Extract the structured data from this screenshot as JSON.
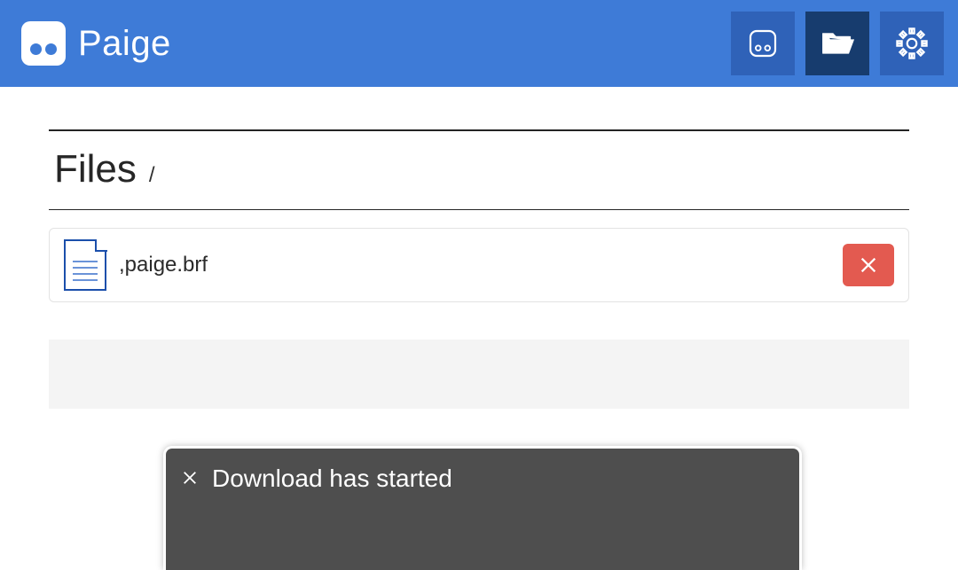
{
  "header": {
    "brand_name": "Paige",
    "buttons": {
      "device": "device-icon",
      "files": "folder-icon",
      "settings": "gear-icon"
    },
    "active": "files"
  },
  "main": {
    "section_title": "Files",
    "breadcrumb_separator": "/",
    "files": [
      {
        "name": ",paige.brf"
      }
    ]
  },
  "toast": {
    "message": "Download has started"
  },
  "colors": {
    "header_bg": "#3e7bd7",
    "header_btn": "#2f62b8",
    "header_btn_active": "#173c6e",
    "delete_btn": "#e35a50",
    "toast_bg": "#4e4e4e"
  }
}
